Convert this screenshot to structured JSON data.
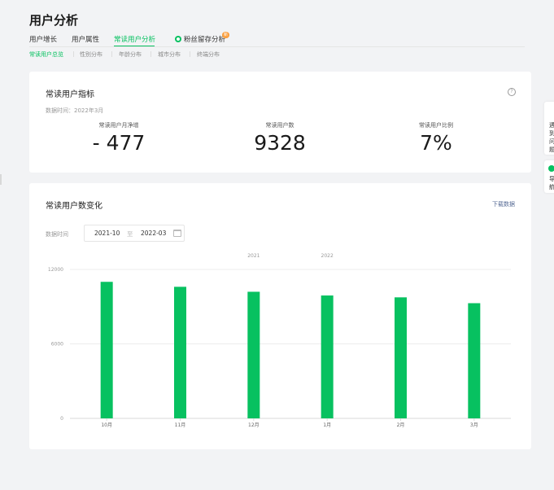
{
  "page": {
    "title": "用户分析"
  },
  "tabs": [
    {
      "label": "用户增长",
      "active": false
    },
    {
      "label": "用户属性",
      "active": false
    },
    {
      "label": "常读用户分析",
      "active": true
    },
    {
      "label": "粉丝留存分析",
      "active": false,
      "icon": "green-circle-icon",
      "badge": "新"
    }
  ],
  "subtabs": [
    {
      "label": "常读用户总览",
      "active": true
    },
    {
      "label": "性别分布",
      "active": false
    },
    {
      "label": "年龄分布",
      "active": false
    },
    {
      "label": "城市分布",
      "active": false
    },
    {
      "label": "终端分布",
      "active": false
    }
  ],
  "metrics_card": {
    "title": "常读用户指标",
    "help_icon": "?",
    "data_time": "数据时间：2022年3月",
    "metrics": [
      {
        "label": "常读用户月净增",
        "value": "- 477"
      },
      {
        "label": "常读用户数",
        "value": "9328"
      },
      {
        "label": "常读用户比例",
        "value": "7%"
      }
    ]
  },
  "trend_card": {
    "title": "常读用户数变化",
    "download_label": "下载数据",
    "filter_label": "数据时间",
    "date_start": "2021-10",
    "date_sep": "至",
    "date_end": "2022-03"
  },
  "right_float": {
    "top_chars": [
      "遇",
      "到",
      "问",
      "题"
    ],
    "bottom_chars": [
      "导",
      "航"
    ]
  },
  "colors": {
    "accent": "#07c160",
    "link": "#576b95",
    "badge": "#fa9d3b",
    "background": "#f2f3f5"
  },
  "chart_data": {
    "type": "bar",
    "categories": [
      "10月",
      "11月",
      "12月",
      "1月",
      "2月",
      "3月"
    ],
    "year_labels": [
      {
        "text": "2021",
        "at_category": "12月"
      },
      {
        "text": "2022",
        "at_category": "1月"
      }
    ],
    "series": [
      {
        "values": [
          11000,
          10600,
          10200,
          9900,
          9750,
          9280
        ],
        "color": "#07c160"
      }
    ],
    "y_ticks": [
      0,
      6000,
      12000
    ],
    "ylim": [
      0,
      12000
    ],
    "grid": true,
    "legend": "none"
  }
}
